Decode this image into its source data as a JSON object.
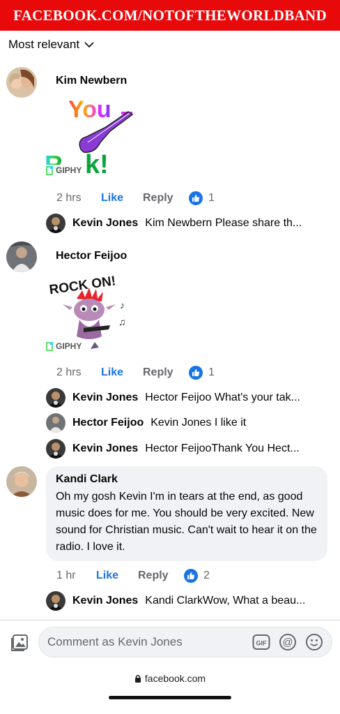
{
  "banner": {
    "text": "FACEBOOK.COM/NOTOFTHEWORLDBAND"
  },
  "sort": {
    "label": "Most relevant"
  },
  "comments": [
    {
      "author": "Kim Newbern",
      "gif_caption": "You Rock!",
      "gif_source": "GIPHY",
      "time": "2 hrs",
      "like_label": "Like",
      "reply_label": "Reply",
      "reaction_count": "1",
      "replies": [
        {
          "author": "Kevin Jones",
          "text": "Kim Newbern Please share th..."
        }
      ]
    },
    {
      "author": "Hector Feijoo",
      "gif_caption": "ROCK ON!",
      "gif_source": "GIPHY",
      "time": "2 hrs",
      "like_label": "Like",
      "reply_label": "Reply",
      "reaction_count": "1",
      "replies": [
        {
          "author": "Kevin Jones",
          "text": "Hector Feijoo What's your tak..."
        },
        {
          "author": "Hector Feijoo",
          "text": "Kevin Jones I like it"
        },
        {
          "author": "Kevin Jones",
          "text": "Hector FeijooThank You Hect..."
        }
      ]
    },
    {
      "author": "Kandi Clark",
      "text": "Oh my gosh Kevin I'm in tears at the end, as good music does for me.  You should be very excited.  New sound for Christian music.  Can't wait to hear it on the radio.  I love it.",
      "time": "1 hr",
      "like_label": "Like",
      "reply_label": "Reply",
      "reaction_count": "2",
      "replies": [
        {
          "author": "Kevin Jones",
          "text": "Kandi ClarkWow, What a beau..."
        }
      ]
    }
  ],
  "composer": {
    "placeholder": "Comment as Kevin Jones",
    "gif_label": "GIF"
  },
  "browser": {
    "url": "facebook.com"
  },
  "colors": {
    "accent": "#1b74e4",
    "banner": "#e8090b",
    "bubble": "#f0f2f5"
  }
}
